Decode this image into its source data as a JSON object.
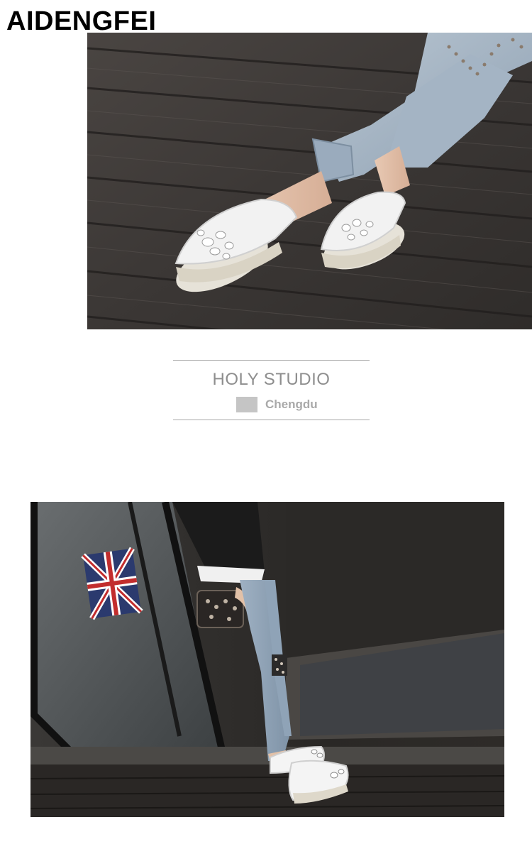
{
  "brand": {
    "name": "AIDENGFEI"
  },
  "studio": {
    "title": "HOLY STUDIO",
    "city": "Chengdu"
  },
  "colors": {
    "brand_text": "#000000",
    "studio_text": "#8e8e8e",
    "rule": "#a9a9a9",
    "swatch": "#c5c5c5",
    "floor_dark": "#3f3a37",
    "denim": "#a8b8c8",
    "shoe_white": "#eeeeee"
  },
  "photos": {
    "top": {
      "subject": "legs-in-denim-white-jeweled-platform-slip-ons-on-wood-deck"
    },
    "bottom": {
      "subject": "woman-in-leather-jacket-and-jeans-at-glass-door-wearing-white-platform-slip-ons"
    }
  }
}
